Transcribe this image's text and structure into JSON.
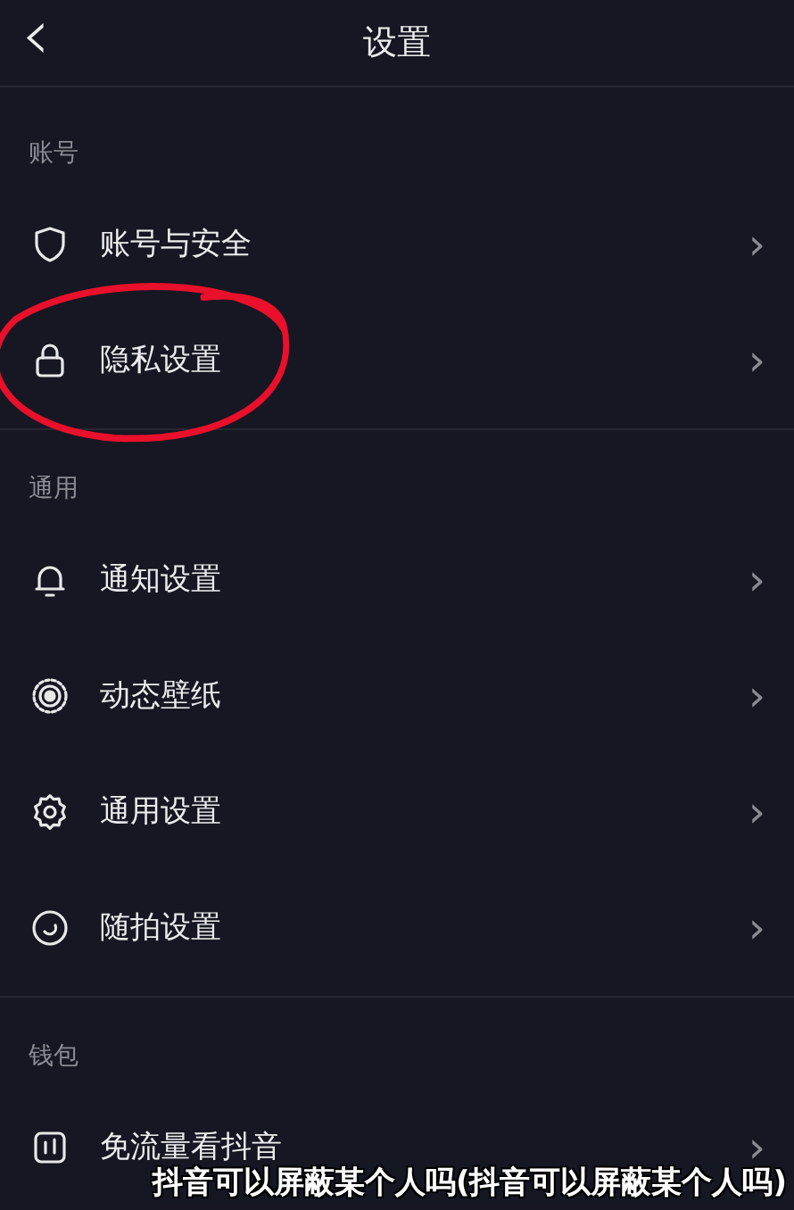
{
  "header": {
    "back_icon": "‹",
    "title": "设置"
  },
  "sections": [
    {
      "label": "账号",
      "divider": true,
      "items": [
        {
          "label": "账号与安全",
          "kind": "shield",
          "chevron": "›",
          "circled": false
        },
        {
          "label": "隐私设置",
          "kind": "lock",
          "chevron": "›",
          "circled": true
        }
      ]
    },
    {
      "label": "通用",
      "divider": true,
      "items": [
        {
          "label": "通知设置",
          "kind": "bell",
          "chevron": "›",
          "circled": false
        },
        {
          "label": "动态壁纸",
          "kind": "wallpaper",
          "chevron": "›",
          "circled": false
        },
        {
          "label": "通用设置",
          "kind": "gear",
          "chevron": "›",
          "circled": false
        },
        {
          "label": "随拍设置",
          "kind": "snap",
          "chevron": "›",
          "circled": false
        }
      ]
    },
    {
      "label": "钱包",
      "divider": false,
      "items": [
        {
          "label": "免流量看抖音",
          "kind": "data",
          "chevron": "›",
          "circled": false
        }
      ]
    }
  ],
  "caption": "抖音可以屏蔽某个人吗(抖音可以屏蔽某个人吗)"
}
